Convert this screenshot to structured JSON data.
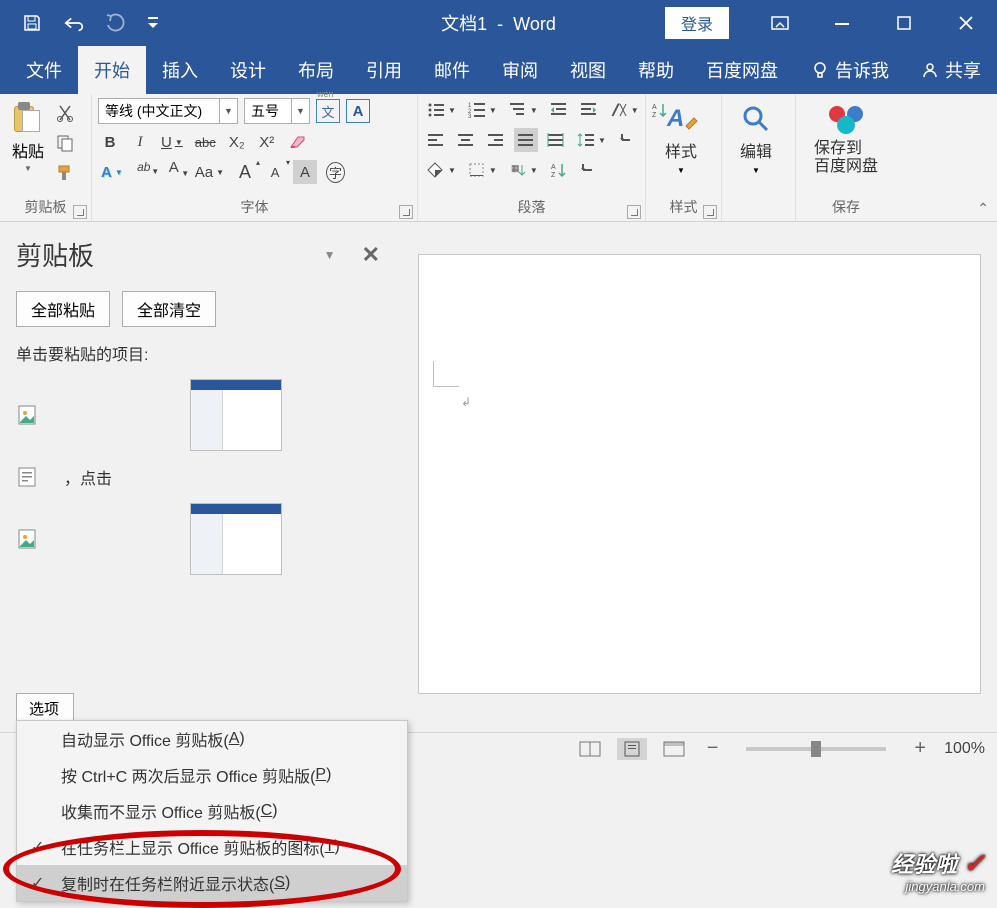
{
  "title": {
    "doc": "文档1",
    "app": "Word"
  },
  "login": "登录",
  "tabs": {
    "file": "文件",
    "home": "开始",
    "insert": "插入",
    "design": "设计",
    "layout": "布局",
    "reference": "引用",
    "mail": "邮件",
    "review": "审阅",
    "view": "视图",
    "help": "帮助",
    "baidu": "百度网盘",
    "tellme": "告诉我",
    "share": "共享"
  },
  "ribbon": {
    "clipboard": {
      "paste": "粘贴",
      "label": "剪贴板"
    },
    "font": {
      "name": "等线 (中文正文)",
      "size": "五号",
      "wen": "文",
      "boxA": "A",
      "bold": "B",
      "italic": "I",
      "underline": "U",
      "strike": "abc",
      "sub": "X₂",
      "sup": "X²",
      "effectA": "A",
      "highlight": "ab",
      "colorA": "A",
      "caseAa": "Aa",
      "big": "A",
      "small": "A",
      "shadeA": "A",
      "circleA": "字",
      "label": "字体"
    },
    "para": {
      "label": "段落"
    },
    "styles": {
      "btn": "样式",
      "label": "样式"
    },
    "editing": {
      "btn": "编辑"
    },
    "save": {
      "btn_l1": "保存到",
      "btn_l2": "百度网盘",
      "label": "保存"
    }
  },
  "pane": {
    "title": "剪贴板",
    "paste_all": "全部粘贴",
    "clear_all": "全部清空",
    "hint": "单击要粘贴的项目:",
    "item2_text": "，点击",
    "options": "选项"
  },
  "menu": {
    "m1": "自动显示 Office 剪贴板(",
    "k1": "A",
    "m1b": ")",
    "m2": "按 Ctrl+C 两次后显示 Office 剪贴版(",
    "k2": "P",
    "m2b": ")",
    "m3": "收集而不显示 Office 剪贴板(",
    "k3": "C",
    "m3b": ")",
    "m4": "在任务栏上显示 Office 剪贴板的图标(",
    "k4": "T",
    "m4b": ")",
    "m5": "复制时在任务栏附近显示状态(",
    "k5": "S",
    "m5b": ")"
  },
  "zoom": "100%",
  "watermark": {
    "title": "经验啦",
    "url": "jingyanla.com"
  }
}
